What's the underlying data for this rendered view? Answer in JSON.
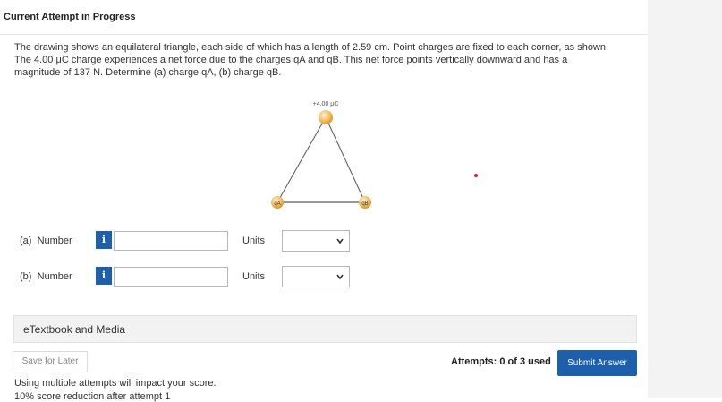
{
  "header": {
    "title": "Current Attempt in Progress"
  },
  "problem": {
    "line1": "The drawing shows an equilateral triangle, each side of which has a length of 2.59 cm. Point charges are fixed to each corner, as shown.",
    "line2": "The 4.00 μC charge experiences a net force due to the charges qA and qB. This net force points vertically downward and has a",
    "line3": "magnitude of 137 N. Determine (a) charge qA, (b) charge qB."
  },
  "figure": {
    "top_label": "+4.00 μC",
    "left_label": "qA",
    "right_label": "qB"
  },
  "answers": [
    {
      "part": "(a)",
      "label": "Number",
      "info": "i",
      "value": "",
      "units_label": "Units",
      "units_value": ""
    },
    {
      "part": "(b)",
      "label": "Number",
      "info": "i",
      "value": "",
      "units_label": "Units",
      "units_value": ""
    }
  ],
  "etext": {
    "label": "eTextbook and Media"
  },
  "footer": {
    "save_label": "Save for Later",
    "attempts_text": "Attempts: 0 of 3 used",
    "submit_label": "Submit Answer",
    "note1": "Using multiple attempts will impact your score.",
    "note2": "10% score reduction after attempt 1"
  },
  "colors": {
    "accent": "#1b5fad",
    "charge": "#f3c060"
  }
}
